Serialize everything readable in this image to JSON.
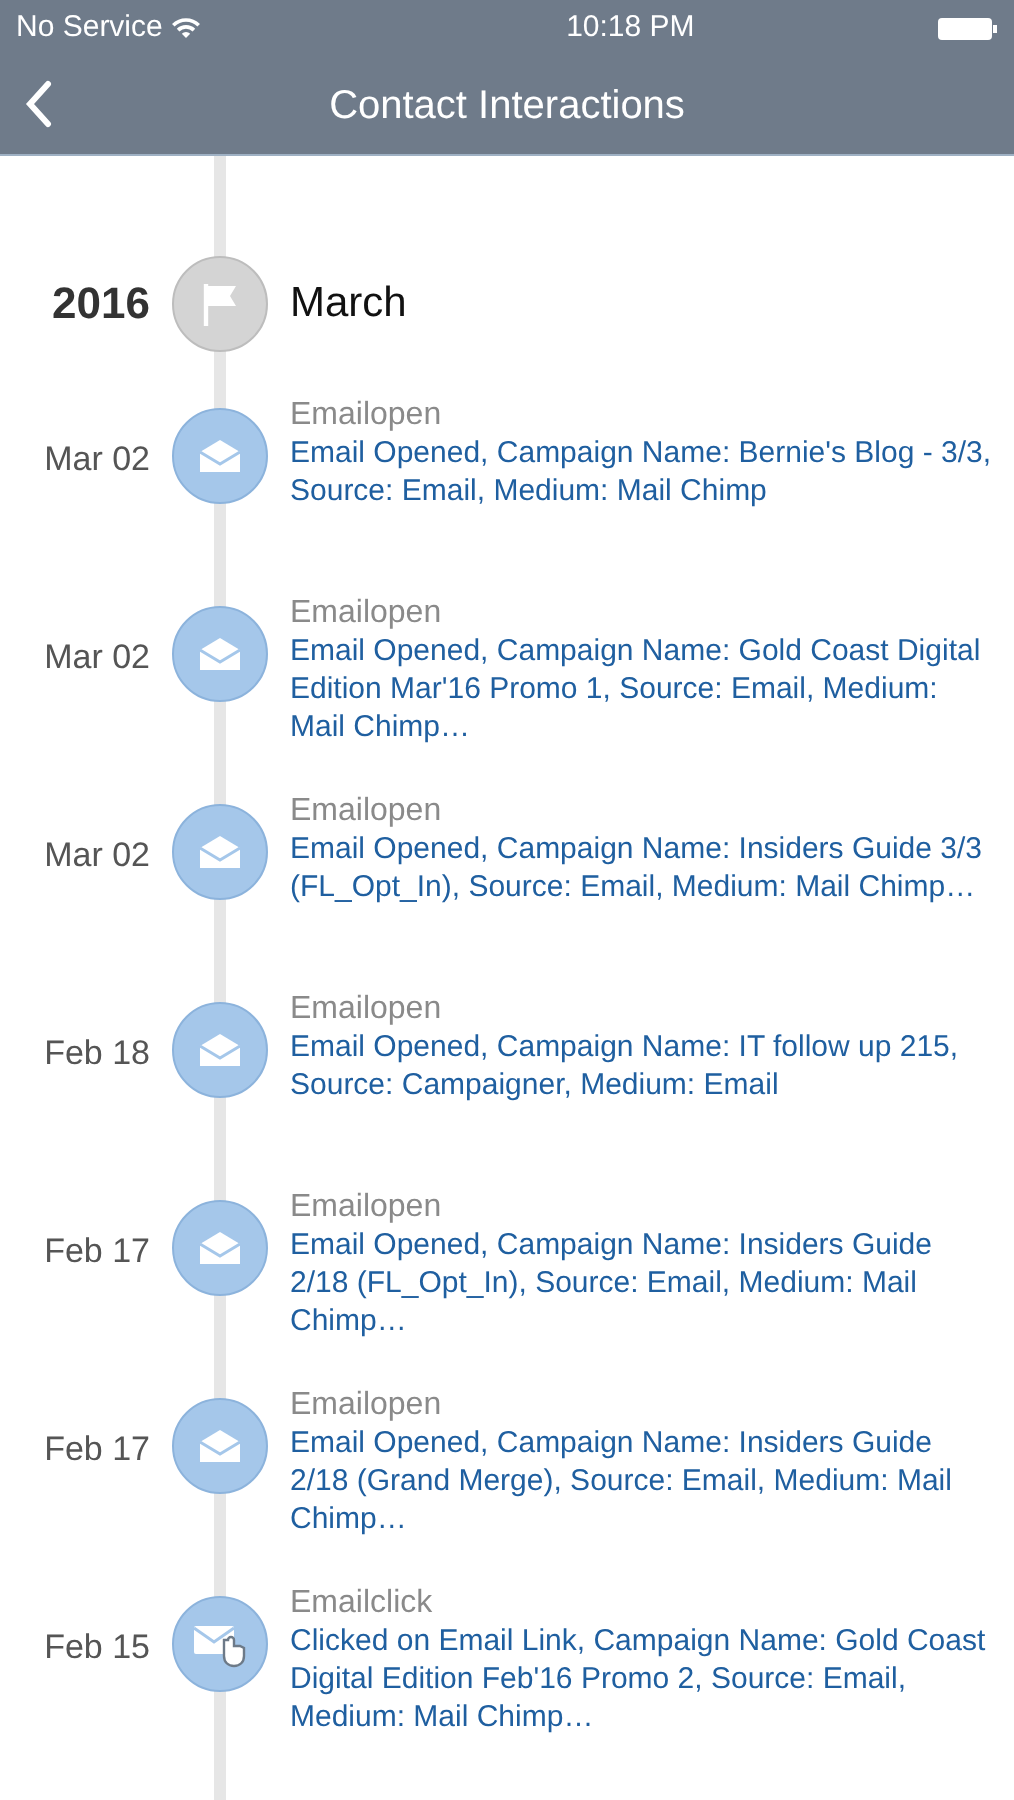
{
  "status_bar": {
    "carrier": "No Service",
    "time": "10:18 PM"
  },
  "nav": {
    "title": "Contact Interactions"
  },
  "timeline": {
    "year": "2016",
    "month": "March",
    "items": [
      {
        "date": "Mar 02",
        "kind": "open",
        "type": "Emailopen",
        "description": "Email Opened, Campaign Name: Bernie's Blog - 3/3, Source: Email, Medium: Mail Chimp"
      },
      {
        "date": "Mar 02",
        "kind": "open",
        "type": "Emailopen",
        "description": "Email Opened, Campaign Name: Gold Coast Digital Edition Mar'16 Promo 1, Source: Email, Medium: Mail Chimp…"
      },
      {
        "date": "Mar 02",
        "kind": "open",
        "type": "Emailopen",
        "description": "Email Opened, Campaign Name: Insiders Guide 3/3 (FL_Opt_In), Source: Email, Medium: Mail Chimp…"
      },
      {
        "date": "Feb 18",
        "kind": "open",
        "type": "Emailopen",
        "description": "Email Opened, Campaign Name: IT follow up 215, Source: Campaigner, Medium: Email"
      },
      {
        "date": "Feb 17",
        "kind": "open",
        "type": "Emailopen",
        "description": "Email Opened, Campaign Name: Insiders Guide 2/18 (FL_Opt_In), Source: Email, Medium: Mail Chimp…"
      },
      {
        "date": "Feb 17",
        "kind": "open",
        "type": "Emailopen",
        "description": "Email Opened, Campaign Name: Insiders Guide 2/18 (Grand Merge), Source: Email, Medium: Mail Chimp…"
      },
      {
        "date": "Feb 15",
        "kind": "click",
        "type": "Emailclick",
        "description": "Clicked on Email Link, Campaign Name: Gold Coast Digital Edition Feb'16 Promo 2, Source: Email, Medium: Mail Chimp…"
      }
    ]
  }
}
